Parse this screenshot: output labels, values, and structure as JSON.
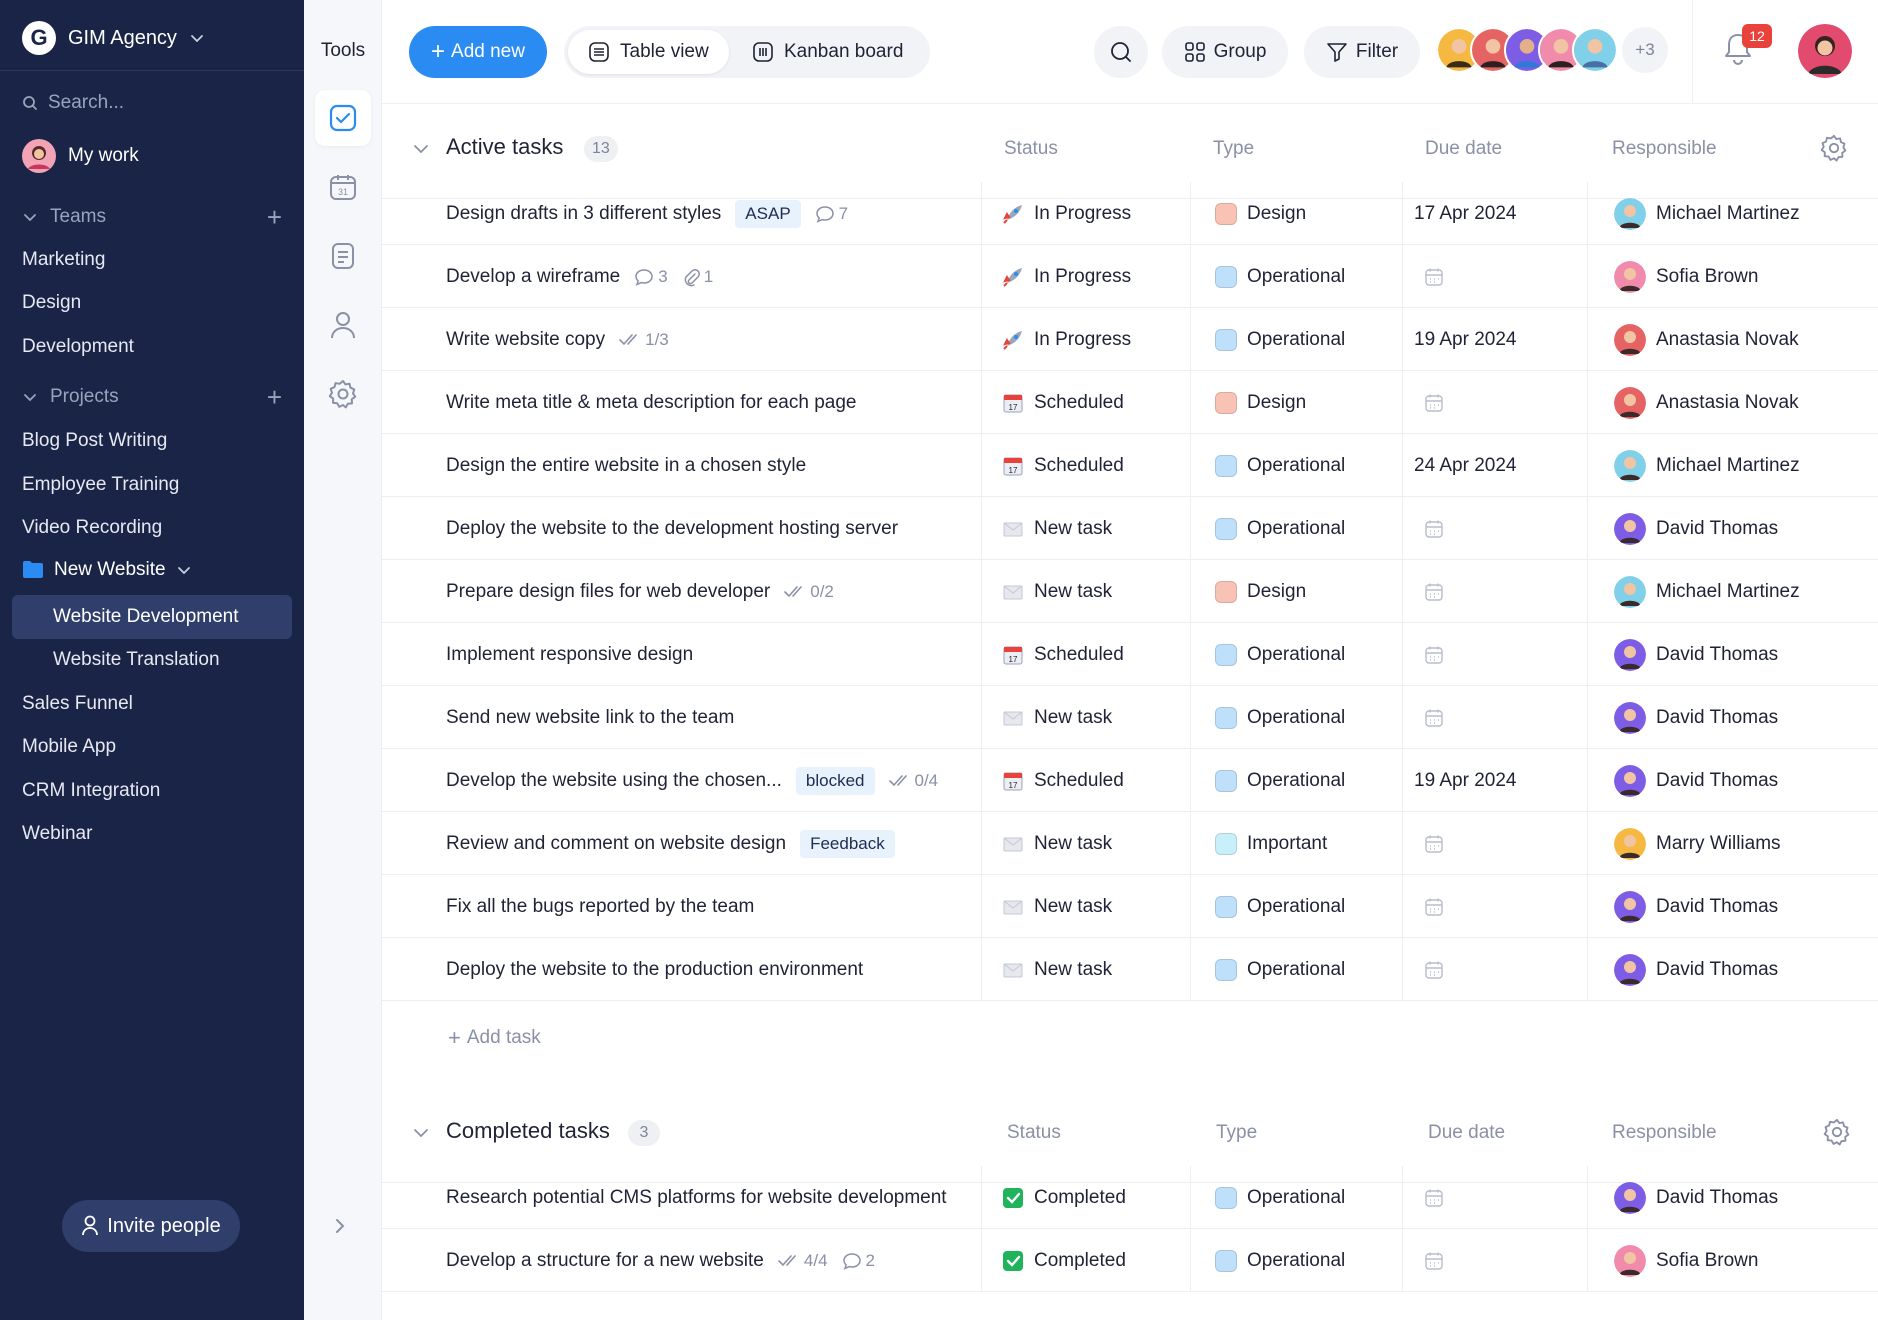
{
  "workspace": {
    "logo_letter": "G",
    "name": "GIM Agency"
  },
  "sidebar": {
    "search_placeholder": "Search...",
    "my_work": "My work",
    "teams_label": "Teams",
    "teams": [
      "Marketing",
      "Design",
      "Development"
    ],
    "projects_label": "Projects",
    "projects_top": [
      "Blog Post Writing",
      "Employee Training",
      "Video Recording"
    ],
    "folder": "New Website",
    "folder_items": [
      "Website Development",
      "Website Translation"
    ],
    "projects_bottom": [
      "Sales Funnel",
      "Mobile App",
      "CRM Integration",
      "Webinar"
    ],
    "invite": "Invite people"
  },
  "tools": {
    "title": "Tools",
    "items": [
      "check-square-icon",
      "calendar-icon",
      "document-icon",
      "person-icon",
      "gear-icon"
    ]
  },
  "topbar": {
    "add_new": "Add new",
    "views": [
      "Table view",
      "Kanban board"
    ],
    "group": "Group",
    "filter": "Filter",
    "more_members": "+3",
    "notifications": "12"
  },
  "colors": {
    "sidebar": "#192446",
    "accent": "#2a8cf2",
    "design": "#f8c3b4",
    "operational": "#bfe0fb",
    "important": "#c9f0fa",
    "completed": "#1fb35a"
  },
  "columns": {
    "status": "Status",
    "type": "Type",
    "due": "Due date",
    "responsible": "Responsible"
  },
  "active": {
    "title": "Active tasks",
    "count": "13",
    "add_task": "Add task",
    "rows": [
      {
        "name": "Design drafts in 3 different styles",
        "tag": "ASAP",
        "comments": "7",
        "status": "In Progress",
        "status_icon": "rocket",
        "type": "Design",
        "due": "17 Apr 2024",
        "person": "Michael Martinez"
      },
      {
        "name": "Develop a wireframe",
        "comments": "3",
        "attachments": "1",
        "status": "In Progress",
        "status_icon": "rocket",
        "type": "Operational",
        "due": "",
        "person": "Sofia Brown"
      },
      {
        "name": "Write website copy",
        "checks": "1/3",
        "status": "In Progress",
        "status_icon": "rocket",
        "type": "Operational",
        "due": "19 Apr 2024",
        "person": "Anastasia Novak"
      },
      {
        "name": "Write meta title & meta description for each page",
        "status": "Scheduled",
        "status_icon": "calendar",
        "type": "Design",
        "due": "",
        "person": "Anastasia Novak"
      },
      {
        "name": "Design the entire website in a chosen style",
        "status": "Scheduled",
        "status_icon": "calendar",
        "type": "Operational",
        "due": "24 Apr 2024",
        "person": "Michael Martinez"
      },
      {
        "name": "Deploy the website to the development hosting server",
        "status": "New task",
        "status_icon": "envelope",
        "type": "Operational",
        "due": "",
        "person": "David Thomas"
      },
      {
        "name": "Prepare design files for web developer",
        "checks": "0/2",
        "status": "New task",
        "status_icon": "envelope",
        "type": "Design",
        "due": "",
        "person": "Michael Martinez"
      },
      {
        "name": "Implement responsive design",
        "status": "Scheduled",
        "status_icon": "calendar",
        "type": "Operational",
        "due": "",
        "person": "David Thomas"
      },
      {
        "name": "Send new website link to the team",
        "status": "New task",
        "status_icon": "envelope",
        "type": "Operational",
        "due": "",
        "person": "David Thomas"
      },
      {
        "name": "Develop the website using the chosen...",
        "tag": "blocked",
        "checks": "0/4",
        "status": "Scheduled",
        "status_icon": "calendar",
        "type": "Operational",
        "due": "19 Apr 2024",
        "person": "David Thomas"
      },
      {
        "name": "Review and comment on website design",
        "tag": "Feedback",
        "status": "New task",
        "status_icon": "envelope",
        "type": "Important",
        "due": "",
        "person": "Marry Williams"
      },
      {
        "name": "Fix all the bugs reported by the team",
        "status": "New task",
        "status_icon": "envelope",
        "type": "Operational",
        "due": "",
        "person": "David Thomas"
      },
      {
        "name": "Deploy the website to the production environment",
        "status": "New task",
        "status_icon": "envelope",
        "type": "Operational",
        "due": "",
        "person": "David Thomas"
      }
    ]
  },
  "completed": {
    "title": "Completed tasks",
    "count": "3",
    "rows": [
      {
        "name": "Research potential CMS platforms for website development",
        "status": "Completed",
        "status_icon": "check",
        "type": "Operational",
        "due": "",
        "person": "David Thomas"
      },
      {
        "name": "Develop a structure for a new website",
        "checks": "4/4",
        "comments": "2",
        "status": "Completed",
        "status_icon": "check",
        "type": "Operational",
        "due": "",
        "person": "Sofia Brown"
      }
    ]
  }
}
